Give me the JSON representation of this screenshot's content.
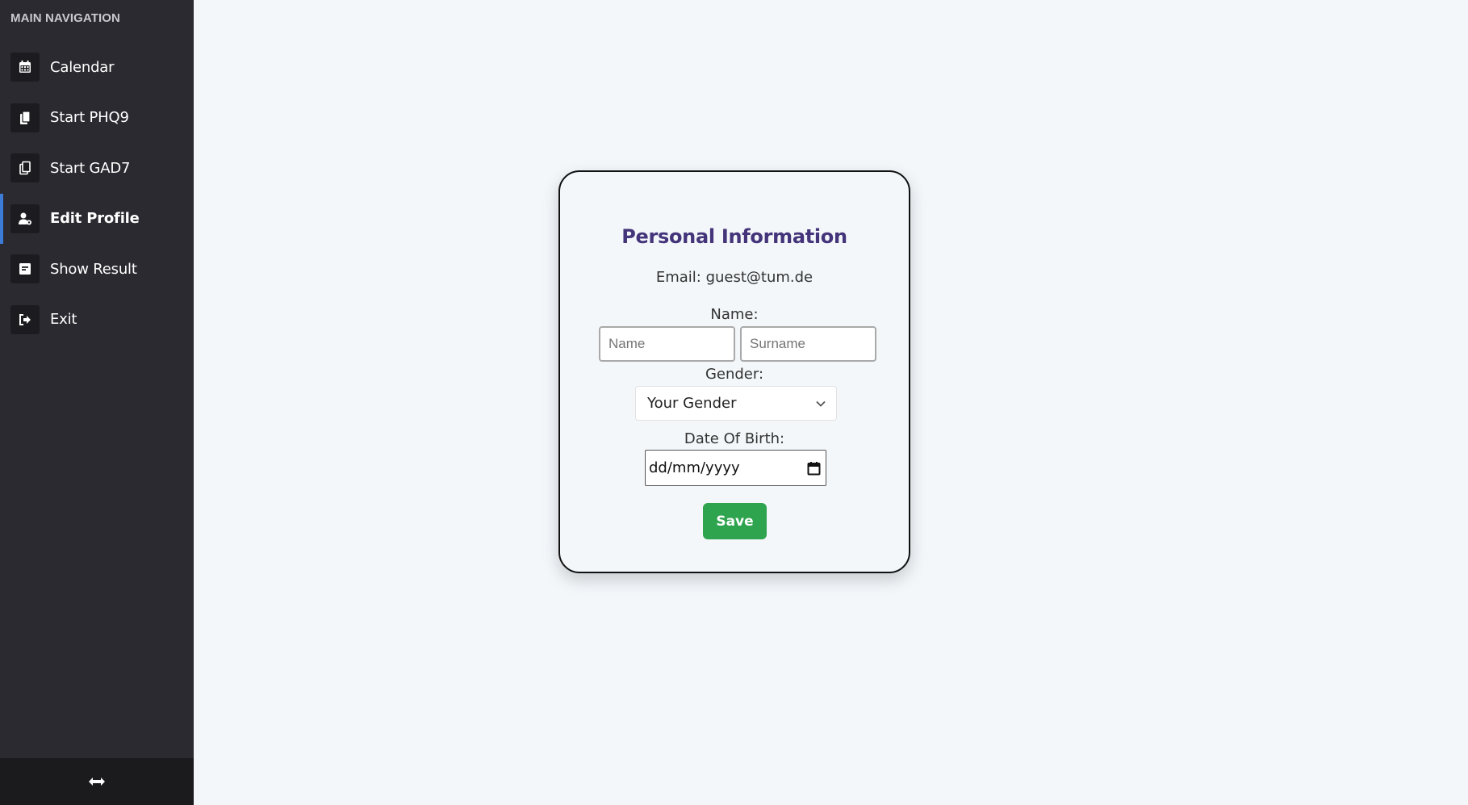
{
  "sidebar": {
    "heading": "MAIN NAVIGATION",
    "items": [
      {
        "label": "Calendar",
        "icon": "calendar-icon"
      },
      {
        "label": "Start PHQ9",
        "icon": "documents-icon"
      },
      {
        "label": "Start GAD7",
        "icon": "copy-icon"
      },
      {
        "label": "Edit Profile",
        "icon": "user-gear-icon",
        "active": true
      },
      {
        "label": "Show Result",
        "icon": "report-icon"
      },
      {
        "label": "Exit",
        "icon": "sign-out-icon"
      }
    ],
    "footer_icon": "resize-arrows-icon"
  },
  "form": {
    "title": "Personal Information",
    "email_line": "Email: guest@tum.de",
    "name_label": "Name:",
    "name_placeholder": "Name",
    "surname_placeholder": "Surname",
    "gender_label": "Gender:",
    "gender_value": "Your Gender",
    "dob_label": "Date Of Birth:",
    "dob_value": "dd/mm/yyyy",
    "save_label": "Save"
  },
  "colors": {
    "sidebar_bg": "#2a2a30",
    "accent": "#3d7bd9",
    "title": "#44347a",
    "save": "#2ea44f",
    "page_bg": "#f3f7fa"
  }
}
